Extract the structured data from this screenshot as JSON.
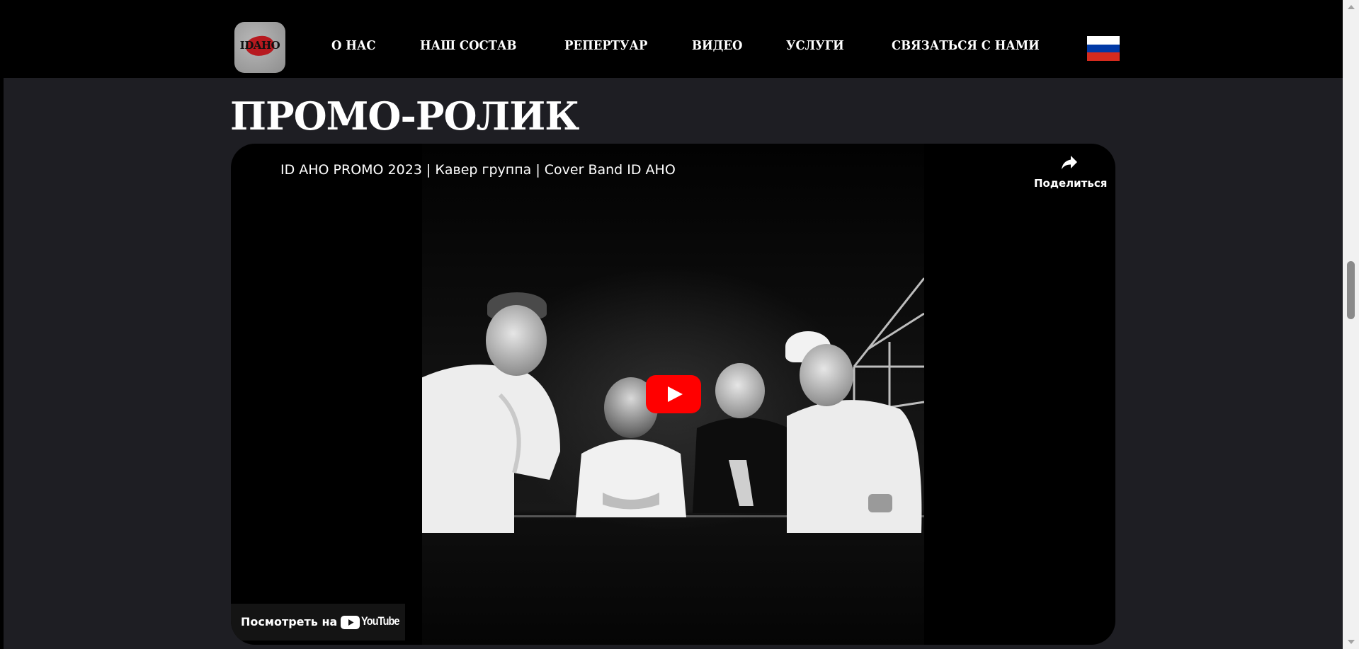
{
  "header": {
    "logo_text": "IDAHO",
    "nav": [
      {
        "label": "О НАС"
      },
      {
        "label": "НАШ СОСТАВ"
      },
      {
        "label": "РЕПЕРТУАР"
      },
      {
        "label": "ВИДЕО"
      },
      {
        "label": "УСЛУГИ"
      },
      {
        "label": "СВЯЗАТЬСЯ С НАМИ"
      }
    ],
    "language_flag": "russian-flag",
    "flag_colors": [
      "#ffffff",
      "#0039a6",
      "#d52b1e"
    ]
  },
  "section": {
    "title": "ПРОМО-РОЛИК"
  },
  "video": {
    "title": "ID AHO PROMO 2023 | Кавер группа | Cover Band ID AHO",
    "share_label": "Поделиться",
    "share_icon": "share-arrow-icon",
    "play_icon": "youtube-play-icon",
    "watch_on_label": "Посмотреть на",
    "youtube_wordmark": "YouTube",
    "play_button_color": "#ff0000"
  },
  "colors": {
    "page_background": "#1e1e23",
    "header_background": "#000000"
  }
}
